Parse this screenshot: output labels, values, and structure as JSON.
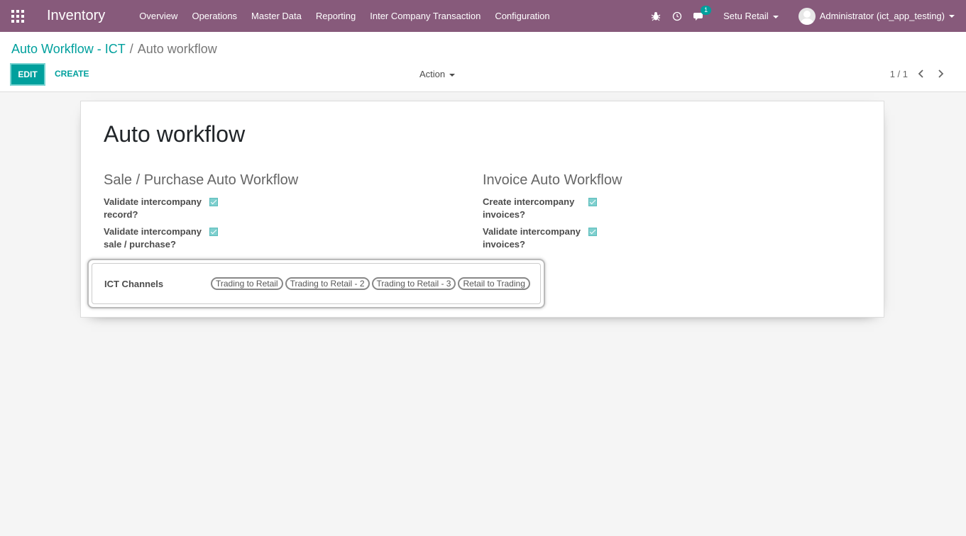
{
  "navbar": {
    "app_name": "Inventory",
    "menu": [
      "Overview",
      "Operations",
      "Master Data",
      "Reporting",
      "Inter Company Transaction",
      "Configuration"
    ],
    "chat_badge": "1",
    "company": "Setu Retail",
    "user": "Administrator (ict_app_testing)"
  },
  "breadcrumb": {
    "parent": "Auto Workflow - ICT",
    "separator": "/",
    "current": "Auto workflow"
  },
  "buttons": {
    "edit": "EDIT",
    "create": "CREATE",
    "action": "Action"
  },
  "pager": {
    "value": "1 / 1"
  },
  "record": {
    "title": "Auto workflow",
    "sale_group": {
      "title": "Sale / Purchase Auto Workflow",
      "fields": [
        {
          "label": "Validate intercompany record?",
          "checked": true
        },
        {
          "label": "Validate intercompany sale / purchase?",
          "checked": true
        }
      ]
    },
    "invoice_group": {
      "title": "Invoice Auto Workflow",
      "fields": [
        {
          "label": "Create intercompany invoices?",
          "checked": true
        },
        {
          "label": "Validate intercompany invoices?",
          "checked": true
        }
      ]
    },
    "ict_channels": {
      "label": "ICT Channels",
      "tags": [
        "Trading to Retail",
        "Trading to Retail - 2",
        "Trading to Retail - 3",
        "Retail to Trading"
      ]
    }
  },
  "colors": {
    "navbar": "#875a7b",
    "accent": "#00a09d"
  }
}
